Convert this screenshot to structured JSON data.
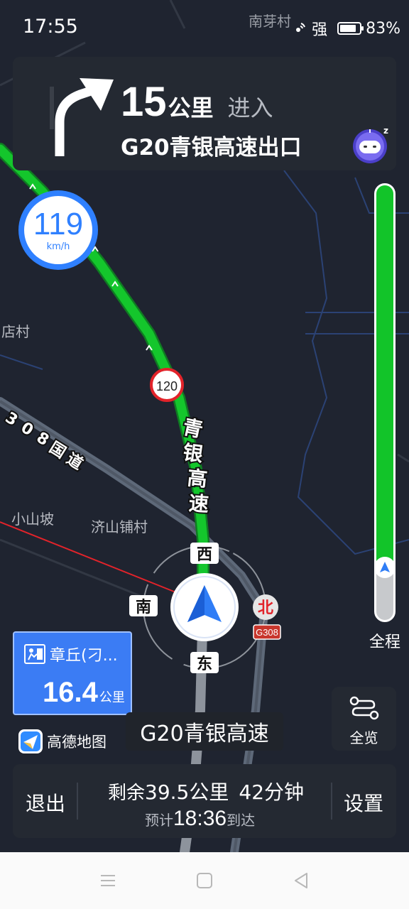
{
  "status_bar": {
    "time": "17:55",
    "signal_text": "强",
    "battery_percent": "83%",
    "battery_level": 0.83
  },
  "navigation": {
    "distance_value": "15",
    "distance_unit": "公里",
    "action": "进入",
    "next_road": "G20青银高速出口",
    "turn_icon": "turn-slight-right-arrow"
  },
  "speed": {
    "value": "119",
    "unit": "km/h"
  },
  "map": {
    "labels": {
      "top_village": "南芽村",
      "left_village": "店村",
      "xiaoshanpo": "小山坡",
      "jishanpu": "济山铺村"
    },
    "highway_name_chars": [
      "青",
      "银",
      "高",
      "速"
    ],
    "national_road_chars": [
      "3",
      "0",
      "8",
      "国",
      "道"
    ],
    "speed_limit_sign": "120",
    "road_shield": "G308",
    "compass": {
      "north": "北",
      "south": "南",
      "east": "东",
      "west": "西"
    }
  },
  "route_progress": {
    "completed_fraction": 0.89,
    "label": "全程"
  },
  "destination": {
    "name": "章丘(刁...",
    "distance_value": "16.4",
    "distance_unit": "公里"
  },
  "logo": {
    "text": "高德地图"
  },
  "current_road": "G20青银高速",
  "overview_button": {
    "label": "全览"
  },
  "bottom_bar": {
    "exit_label": "退出",
    "remaining_prefix": "剩余",
    "remaining_distance": "39.5公里",
    "remaining_time": "42分钟",
    "eta_prefix": "预计",
    "eta_time": "18:36",
    "eta_suffix": "到达",
    "settings_label": "设置"
  },
  "colors": {
    "route_green": "#14c62c",
    "accent_blue": "#2f80ff",
    "map_bg": "#1f2430",
    "panel_bg": "#242932"
  }
}
